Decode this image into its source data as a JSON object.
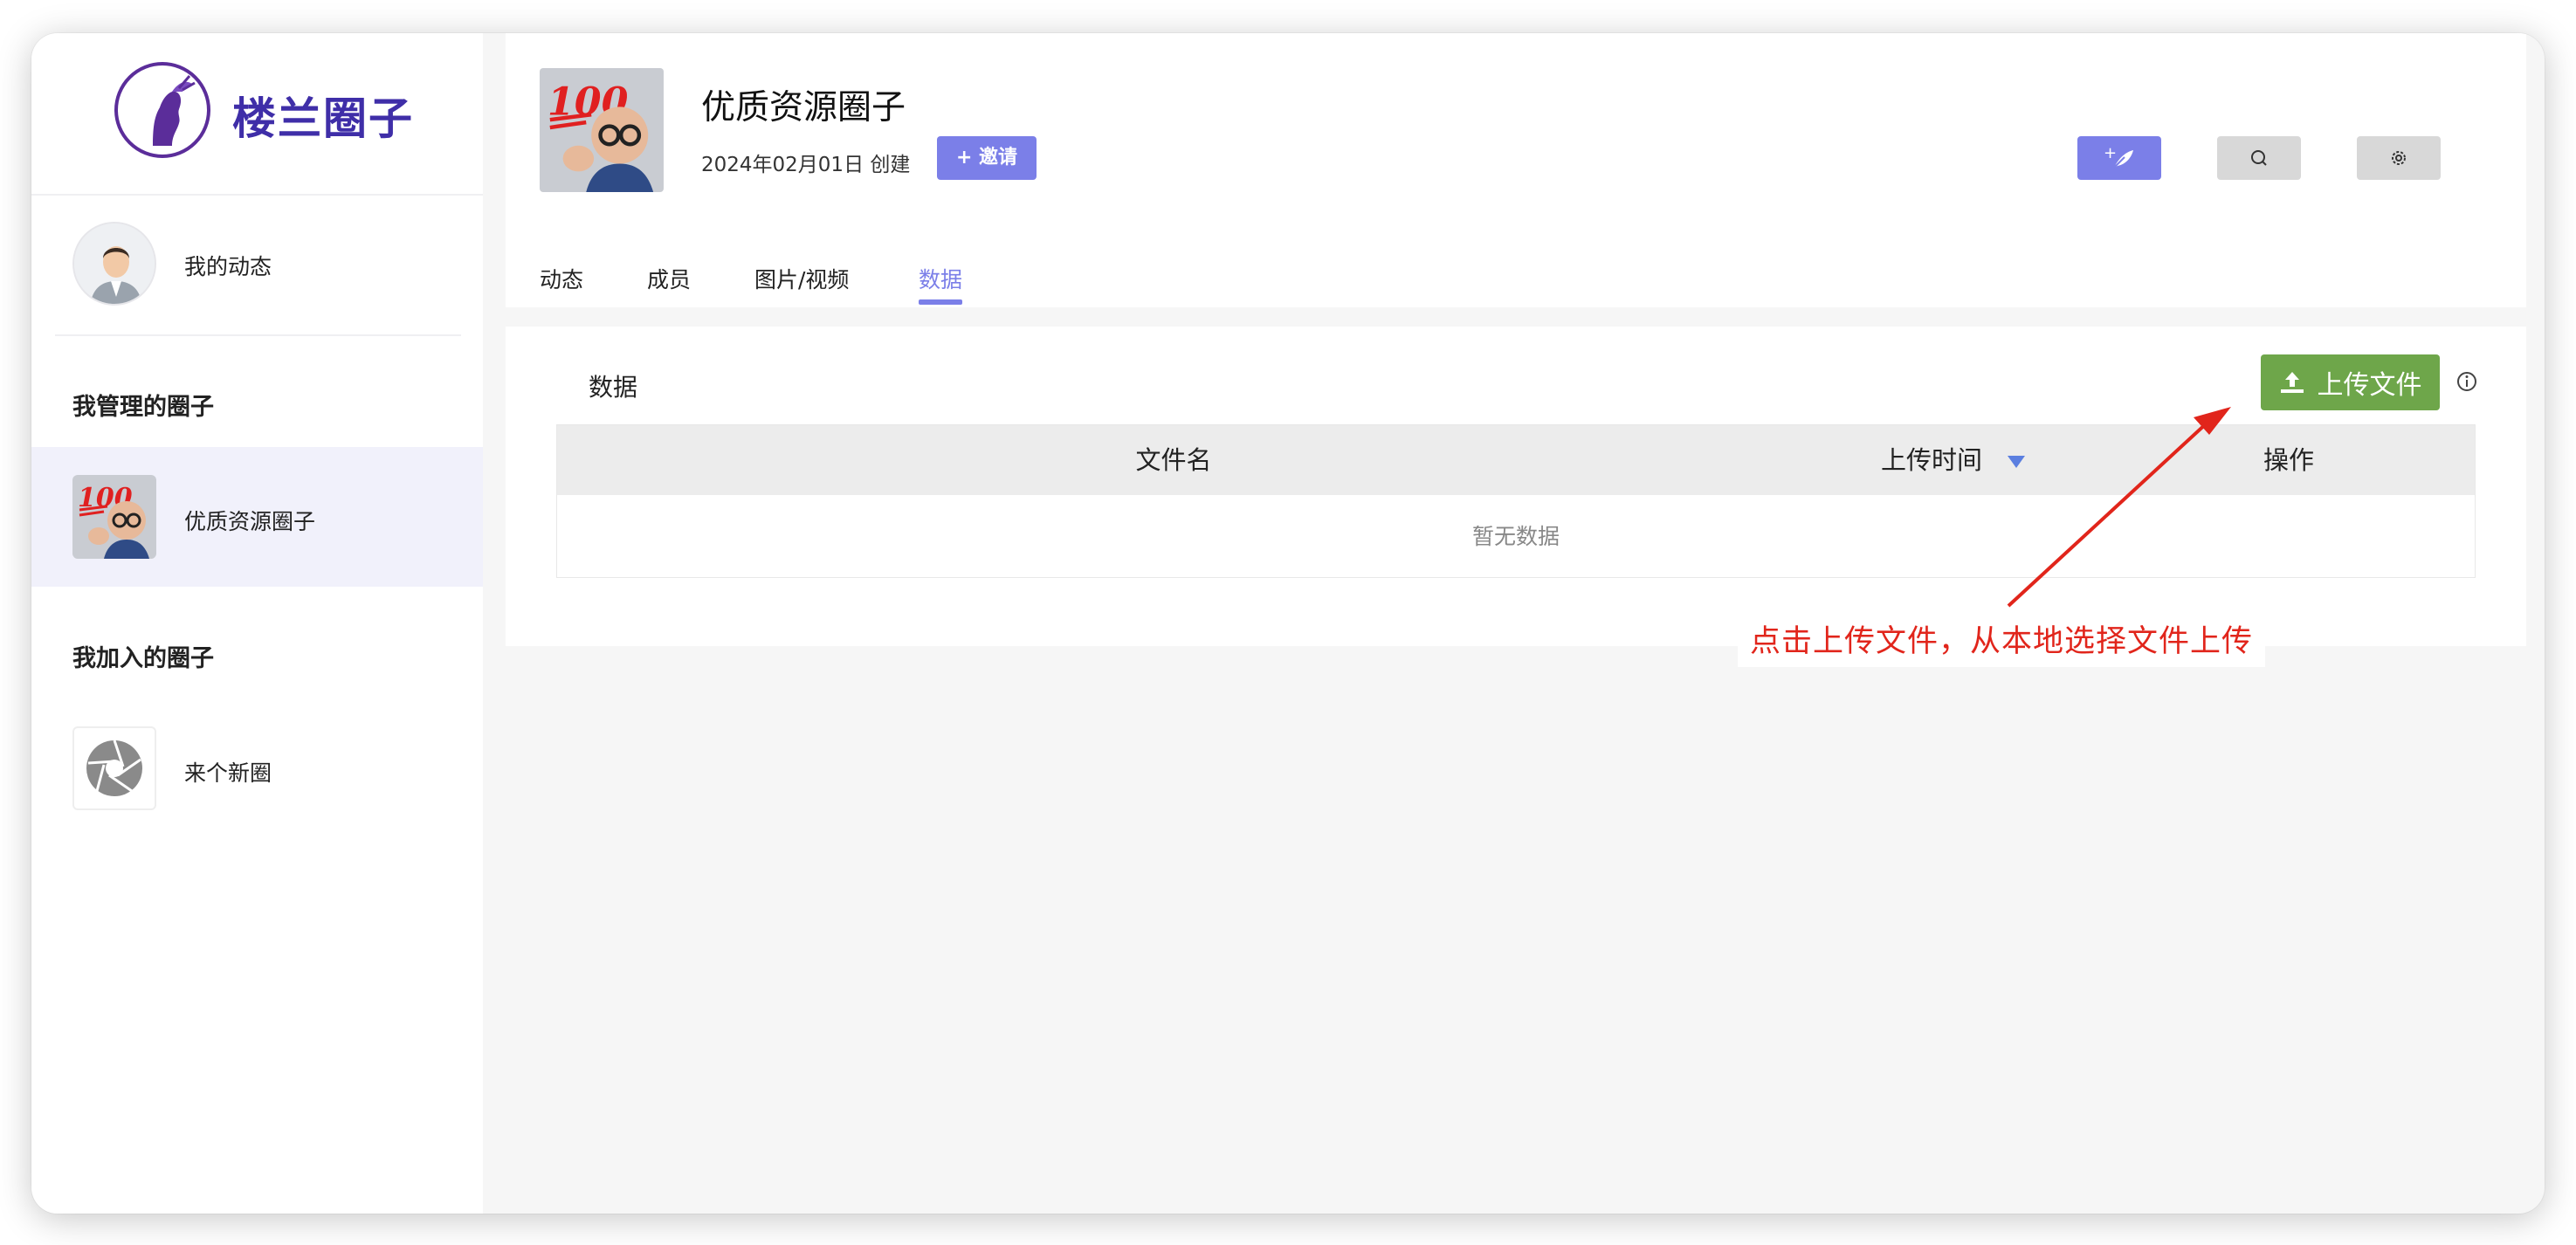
{
  "sidebar": {
    "logo_text": "楼兰圈子",
    "my_feed_label": "我的动态",
    "managed_heading": "我管理的圈子",
    "managed_items": [
      {
        "label": "优质资源圈子"
      }
    ],
    "joined_heading": "我加入的圈子",
    "joined_items": [
      {
        "label": "来个新圈"
      }
    ]
  },
  "header": {
    "group_name": "优质资源圈子",
    "created": "2024年02月01日 创建",
    "invite_label": "+ 邀请"
  },
  "tabs": [
    {
      "label": "动态",
      "active": false
    },
    {
      "label": "成员",
      "active": false
    },
    {
      "label": "图片/视频",
      "active": false
    },
    {
      "label": "数据",
      "active": true
    }
  ],
  "panel": {
    "title": "数据",
    "upload_label": "上传文件",
    "columns": [
      "文件名",
      "上传时间",
      "操作"
    ],
    "empty_text": "暂无数据"
  },
  "annotation": {
    "text": "点击上传文件，从本地选择文件上传"
  },
  "colors": {
    "accent": "#7b7fe8",
    "upload_green": "#6ea64a",
    "annotation_red": "#e1251b",
    "logo_purple": "#3f2ea8"
  }
}
